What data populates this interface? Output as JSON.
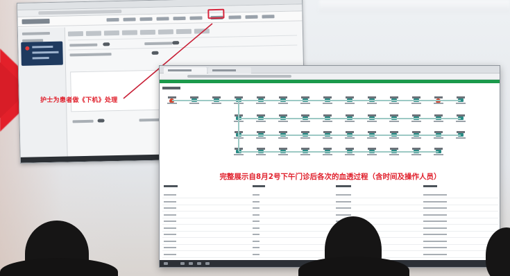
{
  "annotation": {
    "label": "护士为患者做《下机》处理",
    "color": "#e0202c"
  },
  "caption": {
    "text": "完整展示自8月2号下午门诊后各次的血透过程（含时间及操作人员）",
    "color": "#e0202c"
  },
  "colors": {
    "highlight_box": "#d7263d",
    "progress_green": "#1b9a4b",
    "node_teal": "#2a8c86",
    "node_red": "#d2452f",
    "panel_dark": "#1f3a5f"
  },
  "icons": {
    "pointer": "arrow-line",
    "start_node": "red-circle-icon",
    "step_node": "teal-monitor-icon"
  }
}
